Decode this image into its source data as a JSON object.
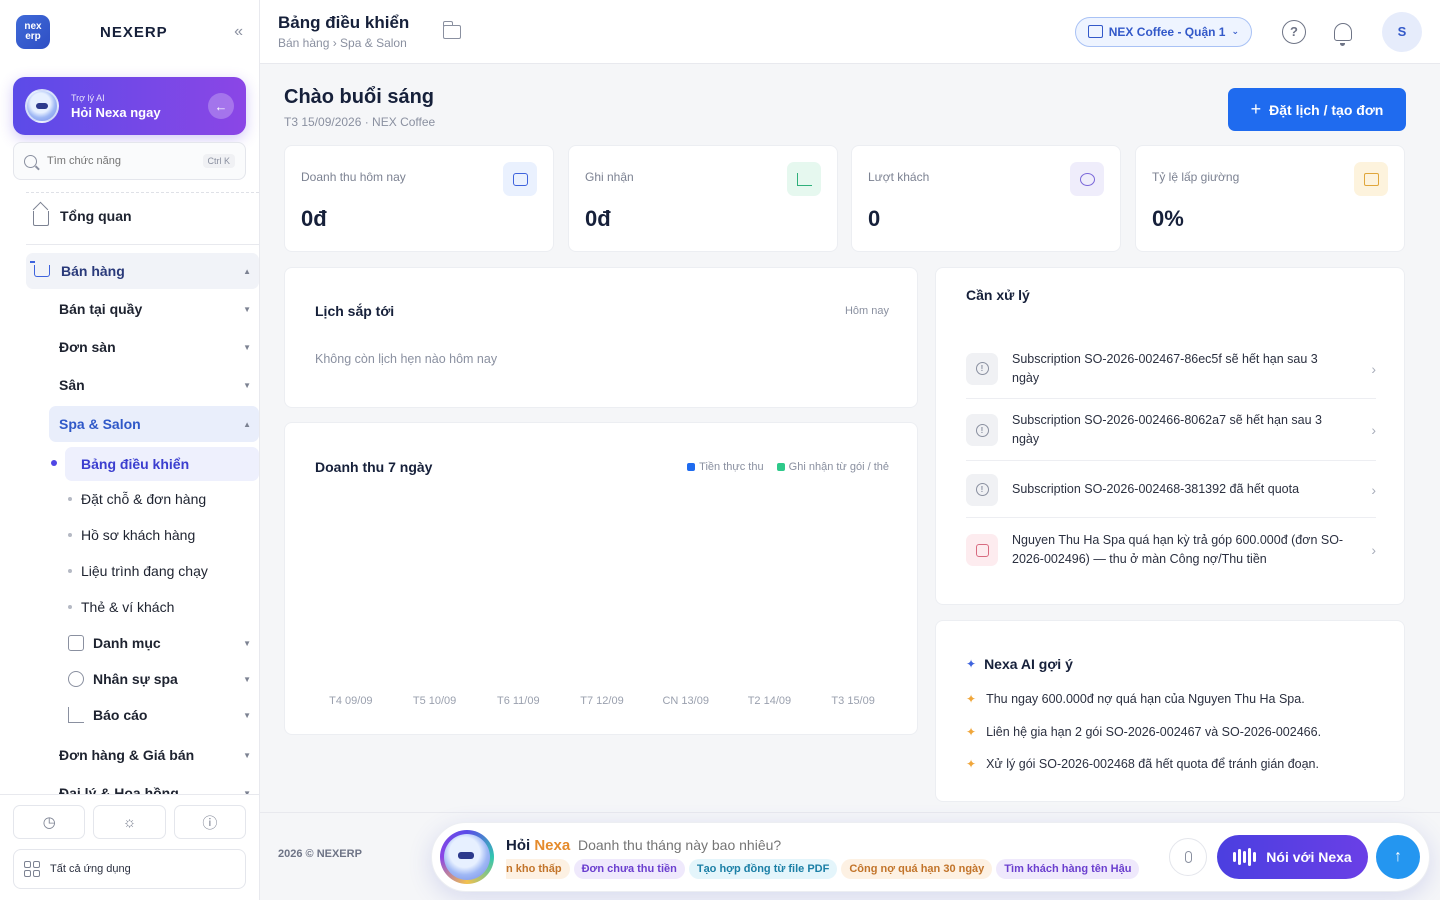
{
  "brand": {
    "logo_top": "nex",
    "logo_bottom": "erp",
    "name": "NEXERP",
    "collapse_glyph": "«"
  },
  "ai_card": {
    "small": "Trợ lý AI",
    "big": "Hỏi Nexa ngay",
    "arrow": "←"
  },
  "search": {
    "placeholder": "Tìm chức năng",
    "shortcut": "Ctrl K"
  },
  "nav": {
    "overview": "Tổng quan",
    "sales": "Bán hàng",
    "pos": "Bán tại quầy",
    "marketplace": "Đơn sàn",
    "court": "Sân",
    "spa": "Spa & Salon",
    "spa_items": [
      "Bảng điều khiển",
      "Đặt chỗ & đơn hàng",
      "Hồ sơ khách hàng",
      "Liệu trình đang chạy",
      "Thẻ & ví khách"
    ],
    "catalog": "Danh mục",
    "staff": "Nhân sự spa",
    "reports": "Báo cáo",
    "orders_prices": "Đơn hàng & Giá bán",
    "agents": "Đại lý & Hoa hồng"
  },
  "sidebar_bottom": {
    "all_apps": "Tất cả ứng dụng"
  },
  "topbar": {
    "title": "Bảng điều khiển",
    "breadcrumb": "Bán hàng › Spa & Salon",
    "store": "NEX Coffee - Quận 1",
    "help": "?",
    "avatar": "S"
  },
  "greeting": {
    "title": "Chào buổi sáng",
    "subtitle": "T3 15/09/2026 · NEX Coffee"
  },
  "cta": {
    "plus": "+",
    "label": "Đặt lịch / tạo đơn"
  },
  "stats": [
    {
      "label": "Doanh thu hôm nay",
      "value": "0đ",
      "color": "#3e63dd",
      "bg": "#eaf1fe"
    },
    {
      "label": "Ghi nhận",
      "value": "0đ",
      "color": "#2fb07b",
      "bg": "#e6f8ef"
    },
    {
      "label": "Lượt khách",
      "value": "0",
      "color": "#7b68d9",
      "bg": "#efedfb"
    },
    {
      "label": "Tỷ lệ lấp giường",
      "value": "0%",
      "color": "#e0a63b",
      "bg": "#fdf3dd"
    }
  ],
  "upcoming": {
    "title": "Lịch sắp tới",
    "range": "Hôm nay",
    "empty": "Không còn lịch hẹn nào hôm nay"
  },
  "revenue": {
    "title": "Doanh thu 7 ngày",
    "legend": [
      {
        "name": "Tiền thực thu",
        "color": "#1f6bef"
      },
      {
        "name": "Ghi nhận từ gói / thẻ",
        "color": "#2ec98a"
      }
    ]
  },
  "chart_data": {
    "type": "bar",
    "title": "Doanh thu 7 ngày",
    "categories": [
      "T4 09/09",
      "T5 10/09",
      "T6 11/09",
      "T7 12/09",
      "CN 13/09",
      "T2 14/09",
      "T3 15/09"
    ],
    "series": [
      {
        "name": "Tiền thực thu",
        "values": [
          0,
          0,
          0,
          0,
          0,
          0,
          0
        ]
      },
      {
        "name": "Ghi nhận từ gói / thẻ",
        "values": [
          0,
          0,
          0,
          0,
          0,
          0,
          0
        ]
      }
    ],
    "legend_position": "top-right",
    "grid": false
  },
  "todo": {
    "title": "Cần xử lý",
    "items": [
      "Subscription SO-2026-002467-86ec5f sẽ hết hạn sau 3 ngày",
      "Subscription SO-2026-002466-8062a7 sẽ hết hạn sau 3 ngày",
      "Subscription SO-2026-002468-381392 đã hết quota",
      "Nguyen Thu Ha Spa quá hạn kỳ trả góp 600.000đ (đơn SO-2026-002496) — thu ở màn Công nợ/Thu tiền"
    ]
  },
  "ai_suggest": {
    "title": "Nexa AI gợi ý",
    "items": [
      "Thu ngay 600.000đ nợ quá hạn của Nguyen Thu Ha Spa.",
      "Liên hệ gia hạn 2 gói SO-2026-002467 và SO-2026-002466.",
      "Xử lý gói SO-2026-002468 đã hết quota để tránh gián đoạn."
    ]
  },
  "footer": {
    "text": "2026 © NEXERP"
  },
  "ask": {
    "title_prefix": "Hỏi",
    "title_brand": "Nexa",
    "placeholder": "Doanh thu tháng này bao nhiêu?",
    "chips": [
      {
        "label": "n kho thấp",
        "color": "#c2742a",
        "bg": "#fdf1e3"
      },
      {
        "label": "Đơn chưa thu tiền",
        "color": "#6b3fcf",
        "bg": "#efe9fc"
      },
      {
        "label": "Tạo hợp đồng từ file PDF",
        "color": "#1b7fa6",
        "bg": "#e4f5fb"
      },
      {
        "label": "Công nợ quá hạn 30 ngày",
        "color": "#c2742a",
        "bg": "#fdf1e3"
      },
      {
        "label": "Tìm khách hàng tên Hậu",
        "color": "#6b3fcf",
        "bg": "#efe9fc"
      }
    ],
    "talk": "Nói với Nexa",
    "send": "↑"
  }
}
